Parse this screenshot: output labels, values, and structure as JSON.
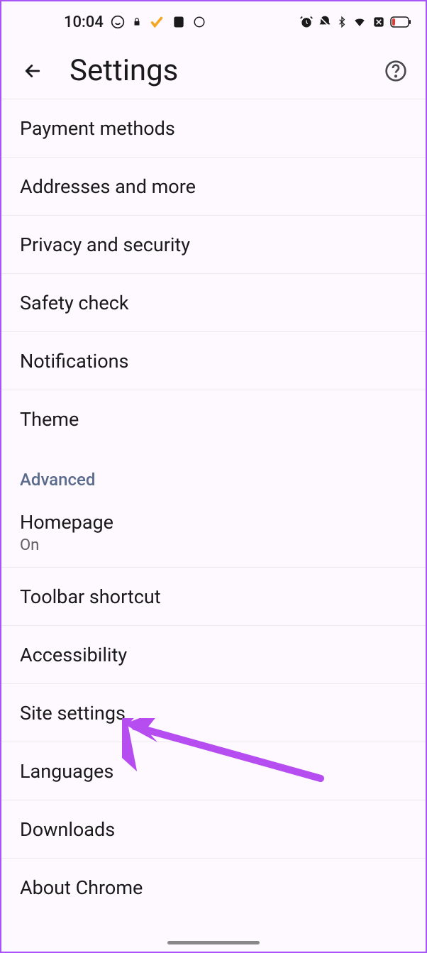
{
  "status": {
    "time": "10:04",
    "icons_left": [
      "whatsapp",
      "lock",
      "check",
      "evernote",
      "atp"
    ],
    "icons_right": [
      "alarm",
      "dnd",
      "bluetooth",
      "wifi",
      "no-sim",
      "battery-low"
    ]
  },
  "header": {
    "title": "Settings"
  },
  "sections": {
    "basic": [
      {
        "label": "Payment methods"
      },
      {
        "label": "Addresses and more"
      },
      {
        "label": "Privacy and security"
      },
      {
        "label": "Safety check"
      },
      {
        "label": "Notifications"
      },
      {
        "label": "Theme"
      }
    ],
    "advanced_header": "Advanced",
    "advanced": [
      {
        "label": "Homepage",
        "sub": "On"
      },
      {
        "label": "Toolbar shortcut"
      },
      {
        "label": "Accessibility"
      },
      {
        "label": "Site settings"
      },
      {
        "label": "Languages"
      },
      {
        "label": "Downloads"
      },
      {
        "label": "About Chrome"
      }
    ]
  },
  "annotation": {
    "color": "#b64df0"
  }
}
